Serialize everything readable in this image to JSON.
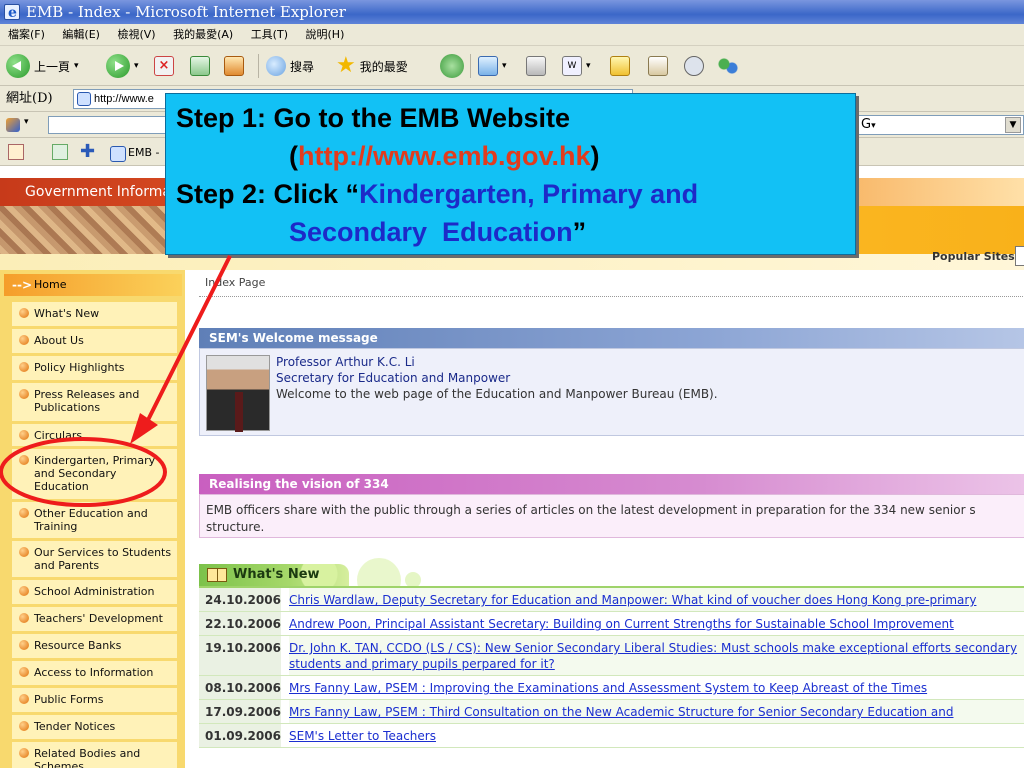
{
  "window": {
    "title": "EMB - Index - Microsoft Internet Explorer"
  },
  "menubar": [
    "檔案(F)",
    "編輯(E)",
    "檢視(V)",
    "我的最愛(A)",
    "工具(T)",
    "說明(H)"
  ],
  "toolbar": {
    "back": "上一頁",
    "search": "搜尋",
    "favorites": "我的最愛"
  },
  "addressbar": {
    "label": "網址(D)",
    "value": "http://www.e"
  },
  "google_toolbar": {
    "select_value": "G"
  },
  "links_tab": {
    "label": "EMB -"
  },
  "site": {
    "gov_label": "Government Informa",
    "popular_sites": "Popular Sites"
  },
  "nav": {
    "home": "Home",
    "items": [
      "What's New",
      "About Us",
      "Policy Highlights",
      "Press Releases and Publications",
      "Circulars",
      "Kindergarten, Primary and Secondary Education",
      "Other Education and Training",
      "Our Services to Students and Parents",
      "School Administration",
      "Teachers' Development",
      "Resource Banks",
      "Access to Information",
      "Public Forms",
      "Tender Notices",
      "Related Bodies and Schemes"
    ]
  },
  "main": {
    "breadcrumb": "Index Page",
    "sem": {
      "heading": "SEM's Welcome message",
      "name": "Professor Arthur K.C. Li",
      "role": "Secretary for Education and Manpower",
      "welcome": "Welcome to the web page of the Education and Manpower Bureau (EMB)."
    },
    "vision": {
      "heading": "Realising the vision of 334",
      "text": "EMB officers share with the public through a series of articles on the latest development in preparation for the 334 new senior s structure."
    },
    "whats_new": {
      "heading": "What's New",
      "rows": [
        {
          "date": "24.10.2006",
          "text": "Chris Wardlaw, Deputy Secretary for Education and Manpower: What kind of voucher does Hong Kong pre-primary"
        },
        {
          "date": "22.10.2006",
          "text": "Andrew Poon, Principal Assistant Secretary: Building on Current Strengths for Sustainable School Improvement"
        },
        {
          "date": "19.10.2006",
          "text": "Dr. John K. TAN, CCDO (LS / CS): New Senior Secondary Liberal Studies: Must schools make exceptional efforts secondary students and primary pupils perpared for it?"
        },
        {
          "date": "08.10.2006",
          "text": "Mrs Fanny Law, PSEM : Improving the Examinations and Assessment System to Keep Abreast of the Times"
        },
        {
          "date": "17.09.2006",
          "text": "Mrs Fanny Law, PSEM : Third Consultation on the New Academic Structure for Senior Secondary Education and"
        },
        {
          "date": "01.09.2006",
          "text": "SEM's Letter to Teachers"
        }
      ]
    }
  },
  "callout": {
    "step1_prefix": "Step 1: Go to the EMB Website",
    "open_paren": "(",
    "url": "http://www.emb.gov.hk",
    "close_paren": ")",
    "step2_prefix": "Step 2: Click “",
    "step2_link_a": "Kindergarten, Primary and",
    "step2_link_b": "Secondary  Education",
    "close_quote": "”"
  },
  "colors": {
    "callout_bg": "#12c1f5",
    "url_red": "#e23b1d",
    "link_blue": "#1d2ac8",
    "annotation_red": "#ee1c1c"
  }
}
